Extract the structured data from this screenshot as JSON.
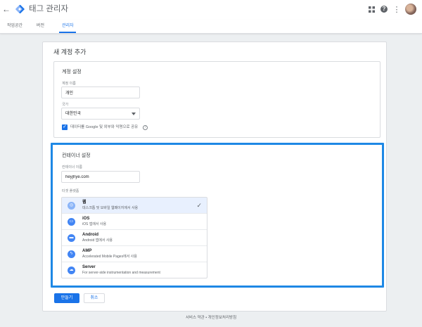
{
  "header": {
    "back_label": "←",
    "app_title": "태그 관리자",
    "help_label": "?",
    "more_label": "⋮"
  },
  "nav": {
    "tabs": [
      {
        "label": "작업공간"
      },
      {
        "label": "버전"
      },
      {
        "label": "관리자"
      }
    ]
  },
  "page": {
    "title": "새 계정 추가"
  },
  "account": {
    "section_title": "계정 설정",
    "name_label": "계정 이름",
    "name_value": "개인",
    "country_label": "국가",
    "country_value": "대한민국",
    "share_label": "데이터를 Google 및 외부와 익명으로 공유",
    "help_label": "?",
    "checked_mark": "✓"
  },
  "container": {
    "section_title": "컨테이너 설정",
    "name_label": "컨테이너 이름",
    "name_value": "heyjhye.com",
    "platform_label": "타겟 플랫폼",
    "selected_mark": "✓",
    "platforms": [
      {
        "name": "웹",
        "desc": "데스크톱 및 모바일 웹페이지에서 사용",
        "icon": "globe-icon",
        "glyph": "◎"
      },
      {
        "name": "iOS",
        "desc": "iOS 앱에서 사용",
        "icon": "ios-icon",
        "glyph": "▭"
      },
      {
        "name": "Android",
        "desc": "Android 앱에서 사용",
        "icon": "android-icon",
        "glyph": "▬"
      },
      {
        "name": "AMP",
        "desc": "Accelerated Mobile Pages에서 사용",
        "icon": "amp-icon",
        "glyph": "ϟ"
      },
      {
        "name": "Server",
        "desc": "For server-side instrumentation and measurement",
        "icon": "cloud-icon",
        "glyph": "☁"
      }
    ]
  },
  "actions": {
    "create_label": "만들기",
    "cancel_label": "취소"
  },
  "footer": {
    "terms_label": "서비스 약관",
    "separator": " • ",
    "privacy_label": "개인정보처리방침"
  },
  "colors": {
    "accent": "#1a73e8",
    "highlight_border": "#1e88e5",
    "selected_row": "#e8f0fe"
  }
}
